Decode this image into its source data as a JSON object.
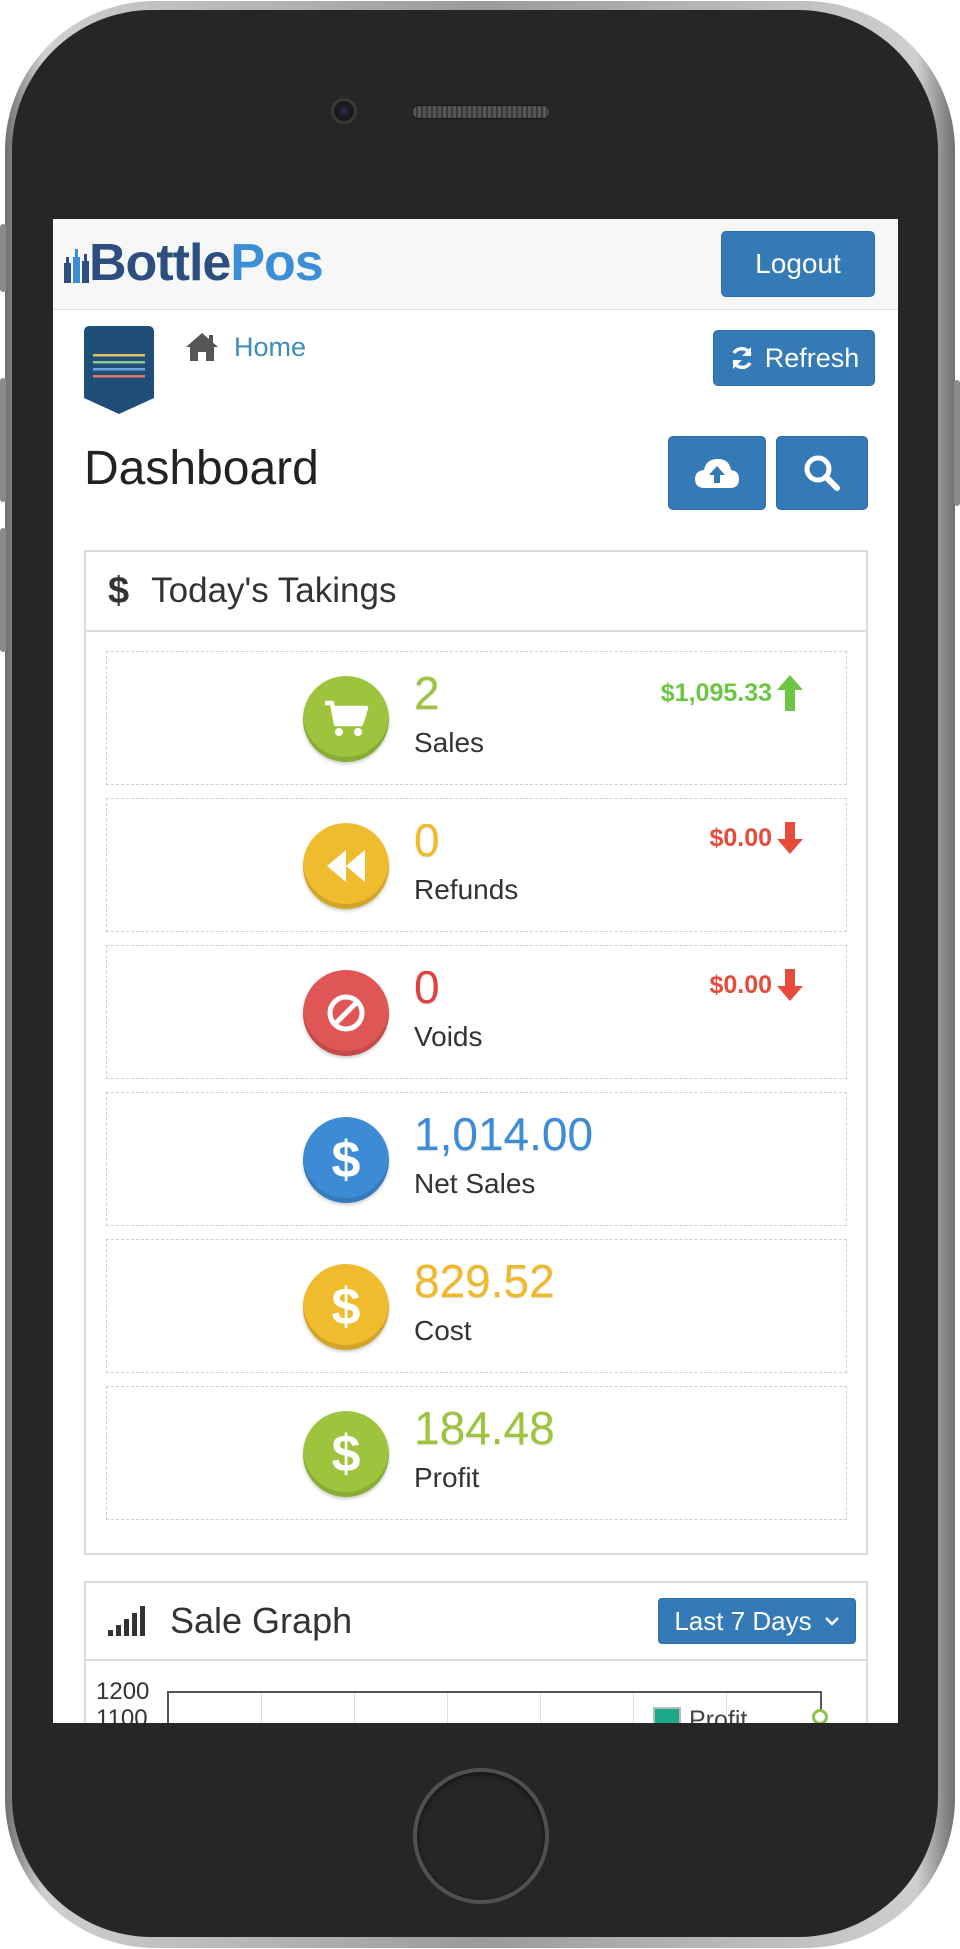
{
  "brand": {
    "name_part1": "Bottle",
    "name_part2": "Pos"
  },
  "header": {
    "logout_label": "Logout",
    "home_label": "Home",
    "refresh_label": "Refresh"
  },
  "page": {
    "title": "Dashboard"
  },
  "takings": {
    "title": "Today's Takings",
    "stats": [
      {
        "value": "2",
        "label": "Sales",
        "trend": "$1,095.33",
        "trend_dir": "up",
        "color": "#8dc63f",
        "icon": "cart-icon"
      },
      {
        "value": "0",
        "label": "Refunds",
        "trend": "$0.00",
        "trend_dir": "down",
        "color": "#f0b92a",
        "icon": "rewind-icon"
      },
      {
        "value": "0",
        "label": "Voids",
        "trend": "$0.00",
        "trend_dir": "down",
        "color": "#e04e4e",
        "icon": "ban-icon"
      },
      {
        "value": "1,014.00",
        "label": "Net Sales",
        "color": "#3c8dd6",
        "icon": "dollar-icon"
      },
      {
        "value": "829.52",
        "label": "Cost",
        "color": "#f0b92a",
        "icon": "dollar-icon"
      },
      {
        "value": "184.48",
        "label": "Profit",
        "color": "#8dc63f",
        "icon": "dollar-icon"
      }
    ],
    "trend_colors": {
      "up": "#6cc644",
      "down": "#e64b3c"
    }
  },
  "sale_graph": {
    "title": "Sale Graph",
    "range_label": "Last 7 Days",
    "y_ticks": [
      "1200",
      "1100"
    ],
    "legend": [
      "Profit"
    ]
  }
}
